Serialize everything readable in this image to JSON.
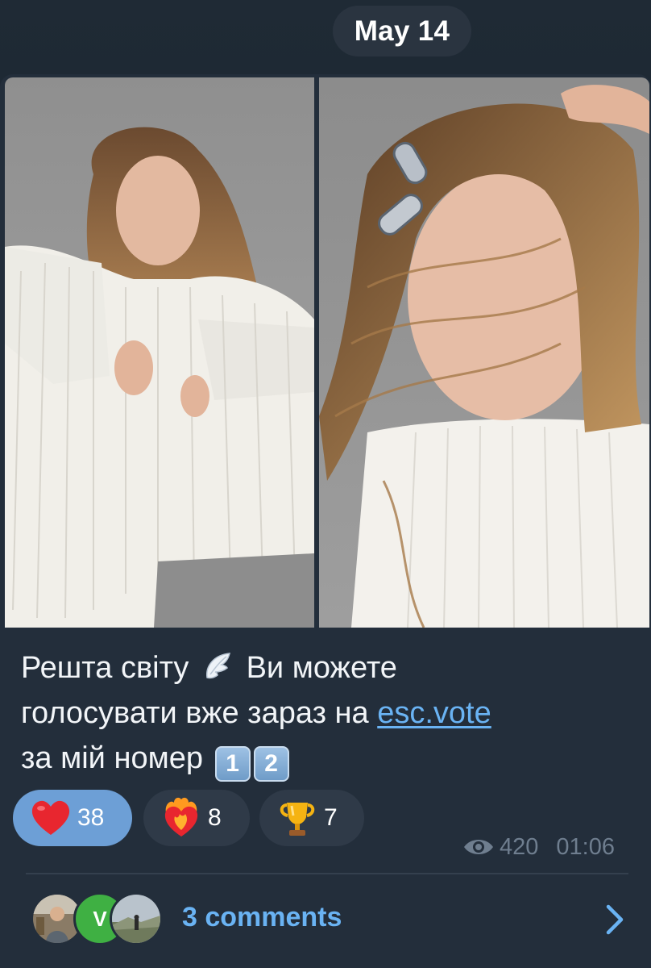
{
  "date_separator": "May 14",
  "caption": {
    "line1": "Решта світу",
    "line1_after": "Ви можете",
    "line2_before": "голосувати вже зараз на ",
    "link": "esc.vote",
    "line3": "за мій номер",
    "keycaps": [
      "1",
      "2"
    ]
  },
  "reactions": [
    {
      "icon": "red-heart-icon",
      "count": "38",
      "active": true
    },
    {
      "icon": "heart-on-fire-icon",
      "count": "8",
      "active": false
    },
    {
      "icon": "trophy-icon",
      "count": "7",
      "active": false
    }
  ],
  "meta": {
    "views": "420",
    "time": "01:06"
  },
  "comments": {
    "label": "3 comments",
    "avatar_initial": "V"
  },
  "colors": {
    "link": "#6ab3f3",
    "active_reaction": "#6d9fd6",
    "bubble": "#232e3b",
    "avatar_green": "#3fb043"
  }
}
